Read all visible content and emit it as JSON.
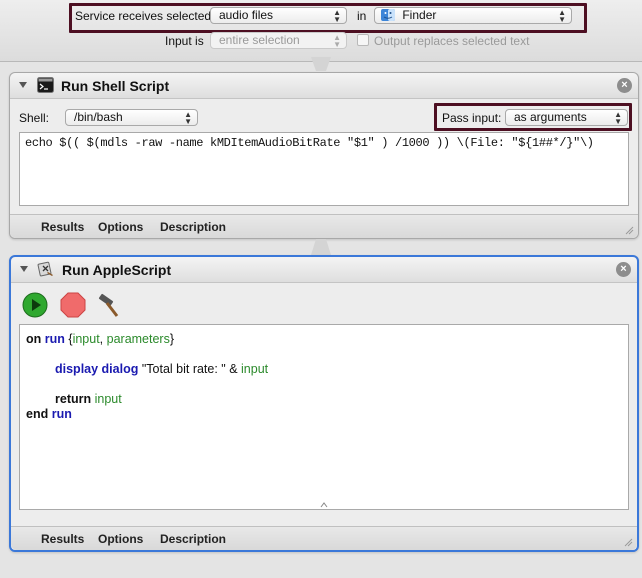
{
  "service": {
    "receives_label": "Service receives selected",
    "type_value": "audio files",
    "in_label": "in",
    "app_value": "Finder",
    "input_is_label": "Input is",
    "input_is_value": "entire selection",
    "output_replaces_label": "Output replaces selected text",
    "output_replaces_checked": false
  },
  "shell_action": {
    "title": "Run Shell Script",
    "shell_label": "Shell:",
    "shell_value": "/bin/bash",
    "pass_input_label": "Pass input:",
    "pass_input_value": "as arguments",
    "script": "echo $(( $(mdls -raw -name kMDItemAudioBitRate \"$1\" ) /1000 )) \\(File: \"${1##*/}\"\\)",
    "tabs": [
      "Results",
      "Options",
      "Description"
    ],
    "close_glyph": "×"
  },
  "applescript_action": {
    "title": "Run AppleScript",
    "tabs": [
      "Results",
      "Options",
      "Description"
    ],
    "close_glyph": "×",
    "code": {
      "l1_kw1": "on",
      "l1_kw2": "run",
      "l1_open": " {",
      "l1_var1": "input",
      "l1_sep": ", ",
      "l1_var2": "parameters",
      "l1_close": "}",
      "l2_kw1": "display dialog",
      "l2_str": " \"Total bit rate: \" & ",
      "l2_var": "input",
      "l3_kw": "return",
      "l3_var": " input",
      "l4_kw1": "end",
      "l4_kw2": " run"
    }
  },
  "colors": {
    "highlight_border": "#4d0f22",
    "selected_action_border": "#3b78d9",
    "keyword_blue": "#1a1ab0",
    "variable_green": "#2b8a2b"
  },
  "icons": {
    "terminal": "terminal-icon",
    "applescript": "applescript-icon",
    "finder": "finder-icon",
    "run": "run-icon",
    "stop": "stop-icon",
    "compile": "compile-hammer-icon"
  }
}
